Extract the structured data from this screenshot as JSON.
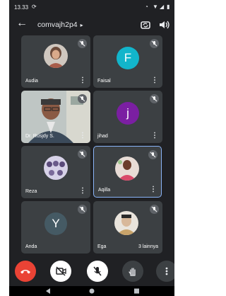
{
  "status_bar": {
    "time": "13.33"
  },
  "header": {
    "room_name": "comvajh2p4"
  },
  "participants": [
    {
      "name": "Audia",
      "muted": true,
      "avatar": "photo"
    },
    {
      "name": "Faisal",
      "muted": true,
      "avatar": "letter",
      "letter": "F",
      "color": "#12b5cb"
    },
    {
      "name": "Dr. Rusjdy S.",
      "muted": true,
      "avatar": "video"
    },
    {
      "name": "jihad",
      "muted": true,
      "avatar": "letter",
      "letter": "j",
      "color": "#7b1fa2"
    },
    {
      "name": "Reza",
      "muted": true,
      "avatar": "photo"
    },
    {
      "name": "Aqilla",
      "muted": true,
      "avatar": "photo",
      "active": true
    },
    {
      "name": "Anda",
      "muted": true,
      "avatar": "letter",
      "letter": "Y",
      "color": "#455a64"
    },
    {
      "name": "Ega",
      "muted": false,
      "avatar": "photo",
      "more_label": "3 lainnya"
    }
  ],
  "controls": [
    {
      "name": "end-call",
      "color": "#ea4335"
    },
    {
      "name": "camera-off",
      "color": "#ffffff"
    },
    {
      "name": "mic-off",
      "color": "#ffffff"
    },
    {
      "name": "raise-hand",
      "color": "#3c4043"
    },
    {
      "name": "more",
      "color": "#3c4043"
    }
  ]
}
